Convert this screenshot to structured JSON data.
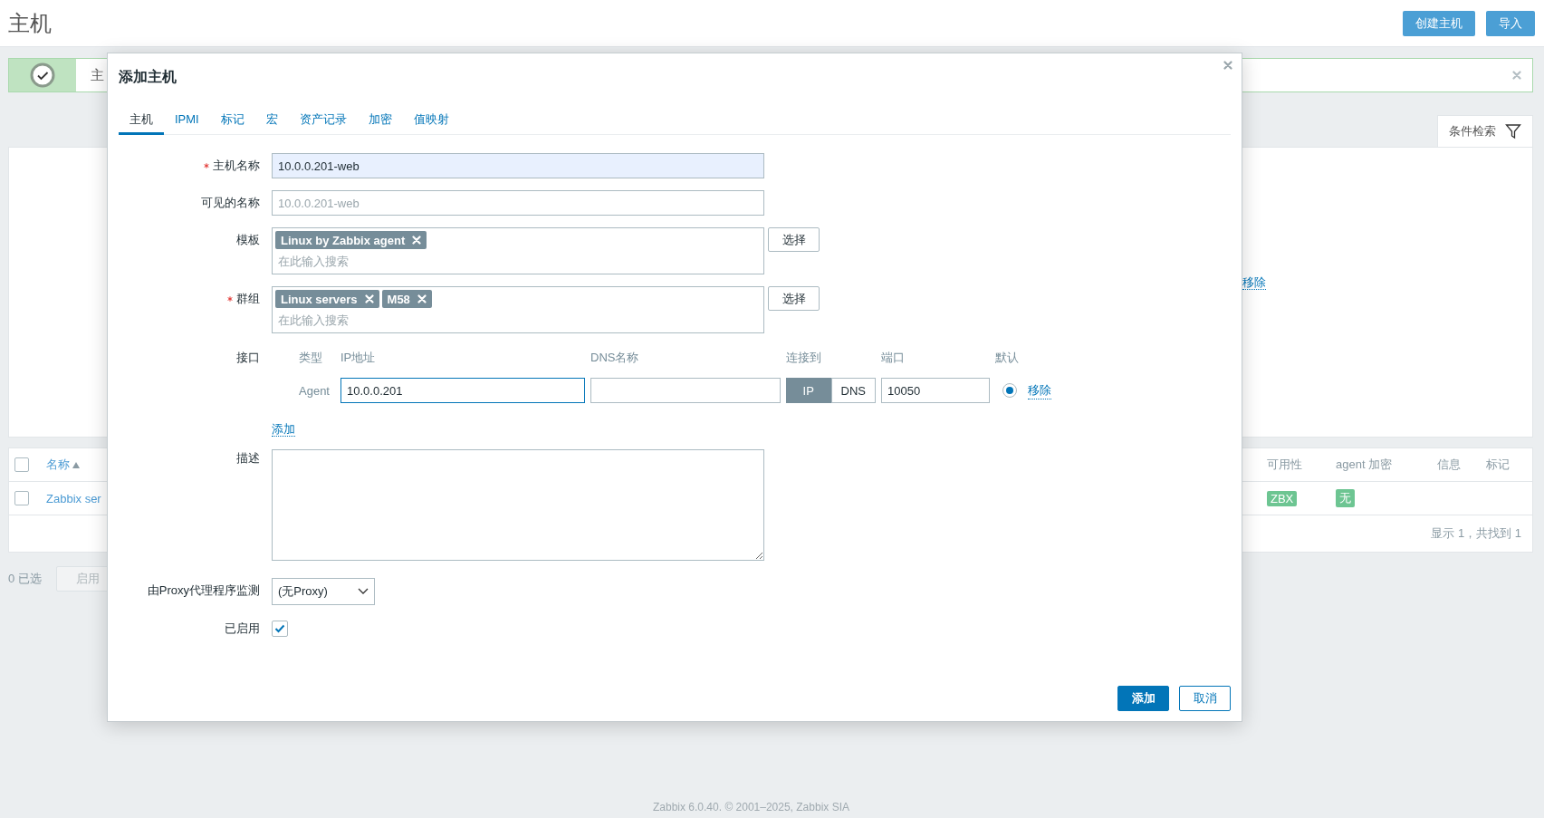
{
  "page": {
    "title": "主机",
    "buttons": [
      "创建主机",
      "导入"
    ]
  },
  "message": {
    "text": "主"
  },
  "filter": {
    "tab": "条件检索",
    "link": "移除"
  },
  "table": {
    "header_checked": false,
    "columns": [
      {
        "label": "名称",
        "sorted": true
      },
      {
        "label": "可用性",
        "sorted": false
      },
      {
        "label": "agent 加密",
        "sorted": false
      },
      {
        "label": "信息",
        "sorted": false
      },
      {
        "label": "标记",
        "sorted": false
      }
    ],
    "rows": [
      {
        "checked": false,
        "name": "Zabbix ser",
        "availability": "ZBX",
        "encryption": "无"
      }
    ],
    "summary": "显示 1，共找到 1"
  },
  "actions": {
    "selected_count": "0 已选",
    "buttons": [
      {
        "label": "启用",
        "disabled": true
      }
    ]
  },
  "footer": "Zabbix 6.0.40. © 2001–2025, Zabbix SIA",
  "dialog": {
    "title": "添加主机",
    "tabs": [
      {
        "label": "主机",
        "selected": true
      },
      {
        "label": "IPMI",
        "selected": false
      },
      {
        "label": "标记",
        "selected": false
      },
      {
        "label": "宏",
        "selected": false
      },
      {
        "label": "资产记录",
        "selected": false
      },
      {
        "label": "加密",
        "selected": false
      },
      {
        "label": "值映射",
        "selected": false
      }
    ],
    "host_name": {
      "label": "主机名称",
      "required": true,
      "value": "10.0.0.201-web"
    },
    "visible_name": {
      "label": "可见的名称",
      "placeholder": "10.0.0.201-web"
    },
    "templates": {
      "label": "模板",
      "tags": [
        "Linux by Zabbix agent"
      ],
      "placeholder": "在此输入搜索",
      "button": "选择"
    },
    "groups": {
      "label": "群组",
      "required": true,
      "tags": [
        "Linux servers",
        "M58"
      ],
      "placeholder": "在此输入搜索",
      "button": "选择"
    },
    "interfaces": {
      "label": "接口",
      "columns": [
        "类型",
        "IP地址",
        "DNS名称",
        "连接到",
        "端口",
        "默认"
      ],
      "rows": [
        {
          "type": "Agent",
          "ip": "10.0.0.201",
          "focused": true,
          "connect": [
            {
              "label": "IP",
              "selected": true
            },
            {
              "label": "DNS",
              "selected": false
            }
          ],
          "port": "10050",
          "default": true,
          "remove": "移除"
        }
      ],
      "add": "添加"
    },
    "description": {
      "label": "描述"
    },
    "proxy": {
      "label": "由Proxy代理程序监测",
      "value": "(无Proxy)"
    },
    "enabled": {
      "label": "已启用",
      "checked": true
    },
    "buttons": [
      {
        "label": "添加",
        "primary": true
      },
      {
        "label": "取消",
        "primary": false
      }
    ]
  }
}
